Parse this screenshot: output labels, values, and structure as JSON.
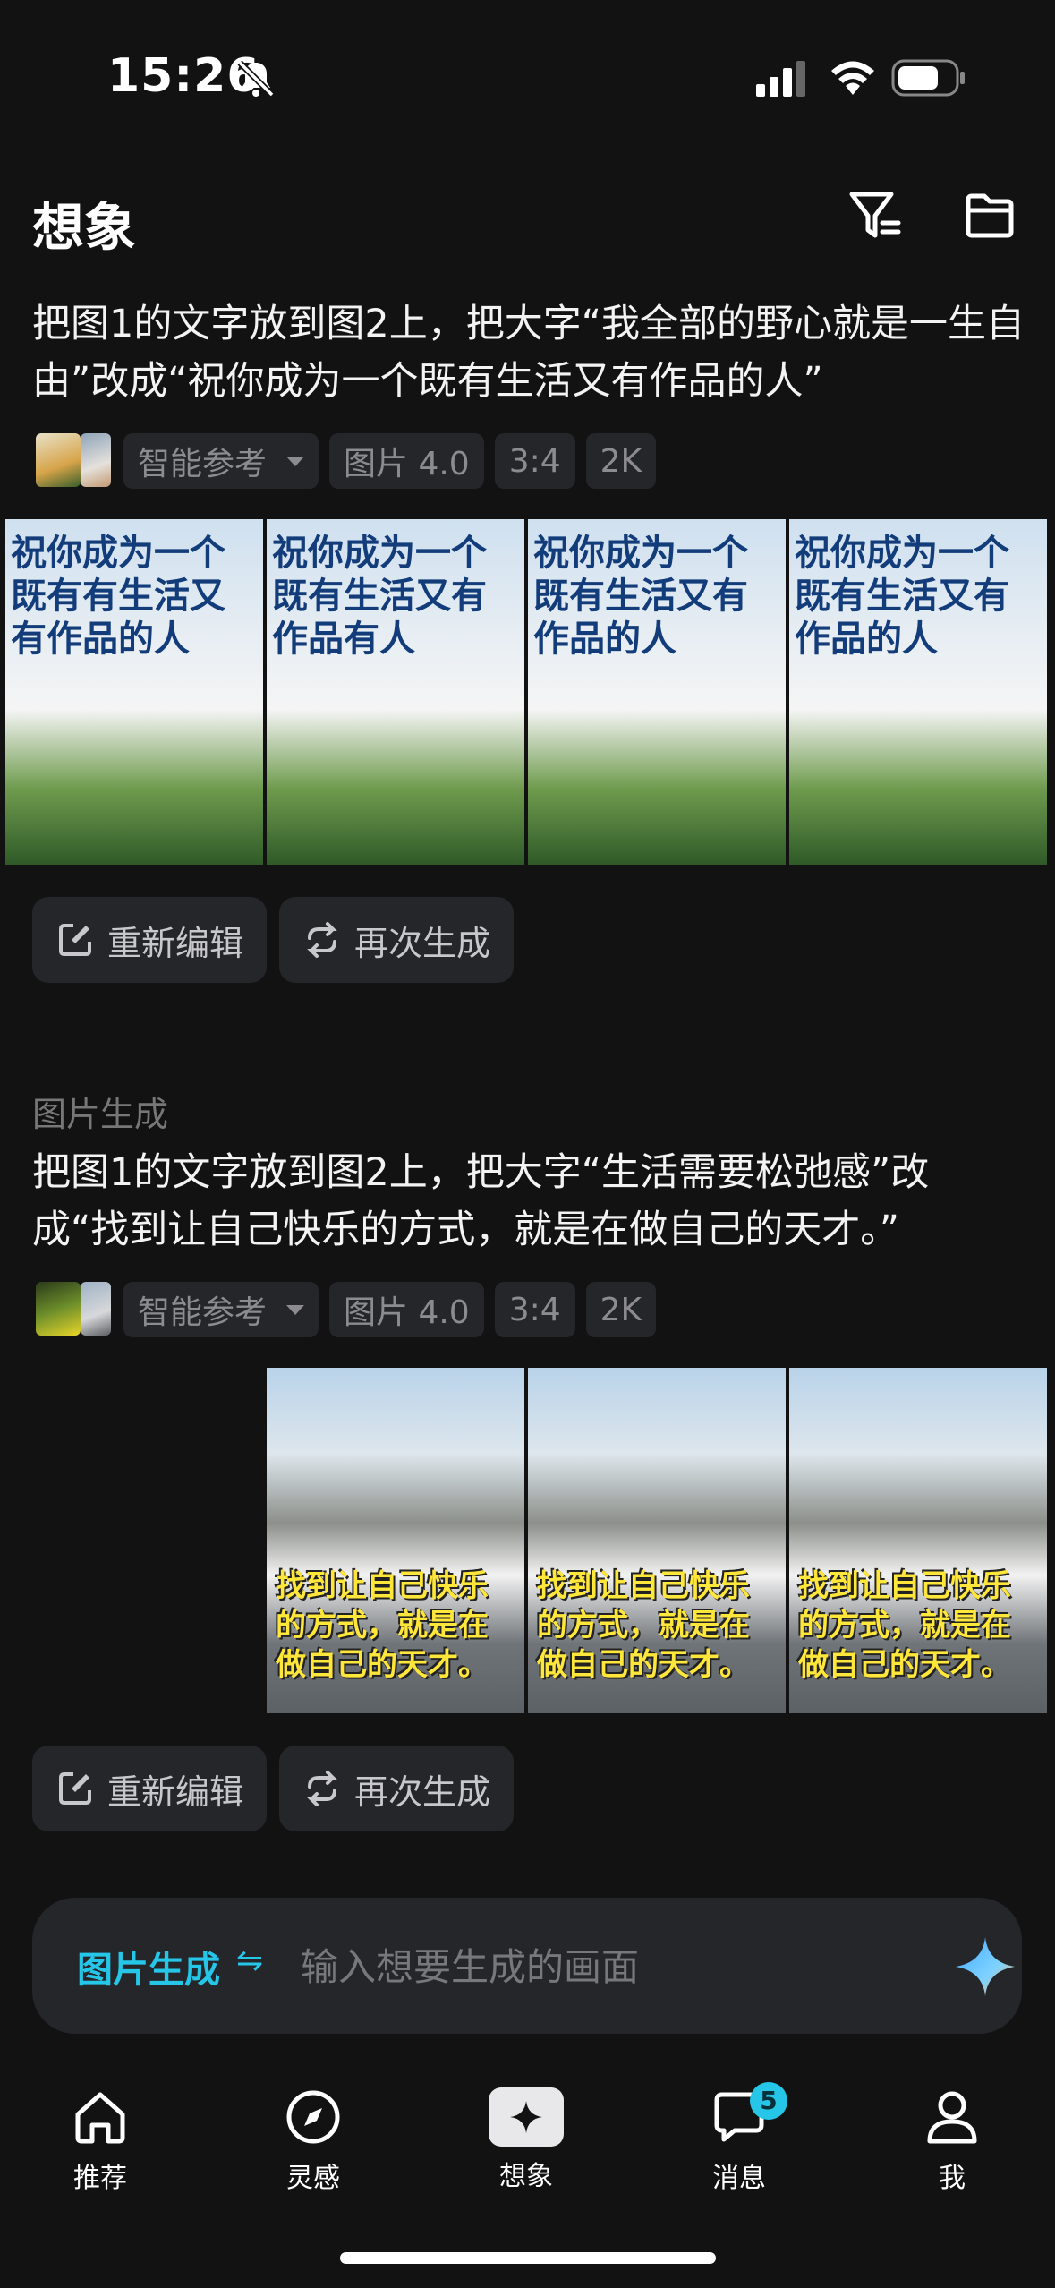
{
  "status_bar": {
    "time": "15:26"
  },
  "header": {
    "title": "想象"
  },
  "generations": [
    {
      "label": "",
      "prompt": "把图1的文字放到图2上，把大字“我全部的野心就是一生自由”改成“祝你成为一个既有生活又有作品的人”",
      "ref_mode": "智能参考",
      "model": "图片 4.0",
      "ratio": "3:4",
      "resolution": "2K",
      "image_texts": [
        "祝你成为一个既有有生活又有作品的人",
        "祝你成为一个既有生活又有作品有人",
        "祝你成为一个既有生活又有作品的人",
        "祝你成为一个既有生活又有作品的人"
      ],
      "edit_label": "重新编辑",
      "regen_label": "再次生成"
    },
    {
      "label": "图片生成",
      "prompt": "把图1的文字放到图2上，把大字“生活需要松弛感”改成“找到让自己快乐的方式，就是在做自己的天才。”",
      "ref_mode": "智能参考",
      "model": "图片 4.0",
      "ratio": "3:4",
      "resolution": "2K",
      "image_texts": [
        "找到让自己快乐的方式，就是在做自己的天才。",
        "找到让自己快乐的方式，就是在做自己的天才。",
        "找到让自己快乐的方式，就是在做自己的天才。"
      ],
      "edit_label": "重新编辑",
      "regen_label": "再次生成"
    }
  ],
  "composer": {
    "mode_label": "图片生成",
    "swap_symbol": "⇋",
    "placeholder": "输入想要生成的画面"
  },
  "nav": {
    "items": [
      {
        "label": "推荐"
      },
      {
        "label": "灵感"
      },
      {
        "label": "想象"
      },
      {
        "label": "消息",
        "badge": "5"
      },
      {
        "label": "我"
      }
    ]
  }
}
